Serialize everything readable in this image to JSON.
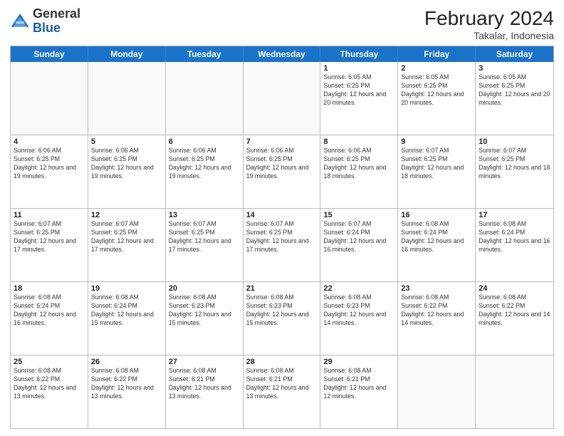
{
  "header": {
    "logo": {
      "general": "General",
      "blue": "Blue"
    },
    "month_year": "February 2024",
    "location": "Takalar, Indonesia"
  },
  "weekdays": [
    "Sunday",
    "Monday",
    "Tuesday",
    "Wednesday",
    "Thursday",
    "Friday",
    "Saturday"
  ],
  "rows": [
    [
      {
        "day": "",
        "info": ""
      },
      {
        "day": "",
        "info": ""
      },
      {
        "day": "",
        "info": ""
      },
      {
        "day": "",
        "info": ""
      },
      {
        "day": "1",
        "info": "Sunrise: 6:05 AM\nSunset: 6:25 PM\nDaylight: 12 hours and 20 minutes."
      },
      {
        "day": "2",
        "info": "Sunrise: 6:05 AM\nSunset: 6:25 PM\nDaylight: 12 hours and 20 minutes."
      },
      {
        "day": "3",
        "info": "Sunrise: 6:05 AM\nSunset: 6:25 PM\nDaylight: 12 hours and 20 minutes."
      }
    ],
    [
      {
        "day": "4",
        "info": "Sunrise: 6:06 AM\nSunset: 6:25 PM\nDaylight: 12 hours and 19 minutes."
      },
      {
        "day": "5",
        "info": "Sunrise: 6:06 AM\nSunset: 6:25 PM\nDaylight: 12 hours and 19 minutes."
      },
      {
        "day": "6",
        "info": "Sunrise: 6:06 AM\nSunset: 6:25 PM\nDaylight: 12 hours and 19 minutes."
      },
      {
        "day": "7",
        "info": "Sunrise: 6:06 AM\nSunset: 6:25 PM\nDaylight: 12 hours and 19 minutes."
      },
      {
        "day": "8",
        "info": "Sunrise: 6:06 AM\nSunset: 6:25 PM\nDaylight: 12 hours and 18 minutes."
      },
      {
        "day": "9",
        "info": "Sunrise: 6:07 AM\nSunset: 6:25 PM\nDaylight: 12 hours and 18 minutes."
      },
      {
        "day": "10",
        "info": "Sunrise: 6:07 AM\nSunset: 6:25 PM\nDaylight: 12 hours and 18 minutes."
      }
    ],
    [
      {
        "day": "11",
        "info": "Sunrise: 6:07 AM\nSunset: 6:25 PM\nDaylight: 12 hours and 17 minutes."
      },
      {
        "day": "12",
        "info": "Sunrise: 6:07 AM\nSunset: 6:25 PM\nDaylight: 12 hours and 17 minutes."
      },
      {
        "day": "13",
        "info": "Sunrise: 6:07 AM\nSunset: 6:25 PM\nDaylight: 12 hours and 17 minutes."
      },
      {
        "day": "14",
        "info": "Sunrise: 6:07 AM\nSunset: 6:25 PM\nDaylight: 12 hours and 17 minutes."
      },
      {
        "day": "15",
        "info": "Sunrise: 6:07 AM\nSunset: 6:24 PM\nDaylight: 12 hours and 16 minutes."
      },
      {
        "day": "16",
        "info": "Sunrise: 6:08 AM\nSunset: 6:24 PM\nDaylight: 12 hours and 16 minutes."
      },
      {
        "day": "17",
        "info": "Sunrise: 6:08 AM\nSunset: 6:24 PM\nDaylight: 12 hours and 16 minutes."
      }
    ],
    [
      {
        "day": "18",
        "info": "Sunrise: 6:08 AM\nSunset: 6:24 PM\nDaylight: 12 hours and 16 minutes."
      },
      {
        "day": "19",
        "info": "Sunrise: 6:08 AM\nSunset: 6:24 PM\nDaylight: 12 hours and 15 minutes."
      },
      {
        "day": "20",
        "info": "Sunrise: 6:08 AM\nSunset: 6:23 PM\nDaylight: 12 hours and 15 minutes."
      },
      {
        "day": "21",
        "info": "Sunrise: 6:08 AM\nSunset: 6:23 PM\nDaylight: 12 hours and 15 minutes."
      },
      {
        "day": "22",
        "info": "Sunrise: 6:08 AM\nSunset: 6:23 PM\nDaylight: 12 hours and 14 minutes."
      },
      {
        "day": "23",
        "info": "Sunrise: 6:08 AM\nSunset: 6:22 PM\nDaylight: 12 hours and 14 minutes."
      },
      {
        "day": "24",
        "info": "Sunrise: 6:08 AM\nSunset: 6:22 PM\nDaylight: 12 hours and 14 minutes."
      }
    ],
    [
      {
        "day": "25",
        "info": "Sunrise: 6:08 AM\nSunset: 6:22 PM\nDaylight: 12 hours and 13 minutes."
      },
      {
        "day": "26",
        "info": "Sunrise: 6:08 AM\nSunset: 6:22 PM\nDaylight: 12 hours and 13 minutes."
      },
      {
        "day": "27",
        "info": "Sunrise: 6:08 AM\nSunset: 6:21 PM\nDaylight: 12 hours and 13 minutes."
      },
      {
        "day": "28",
        "info": "Sunrise: 6:08 AM\nSunset: 6:21 PM\nDaylight: 12 hours and 13 minutes."
      },
      {
        "day": "29",
        "info": "Sunrise: 6:08 AM\nSunset: 6:21 PM\nDaylight: 12 hours and 12 minutes."
      },
      {
        "day": "",
        "info": ""
      },
      {
        "day": "",
        "info": ""
      }
    ]
  ]
}
